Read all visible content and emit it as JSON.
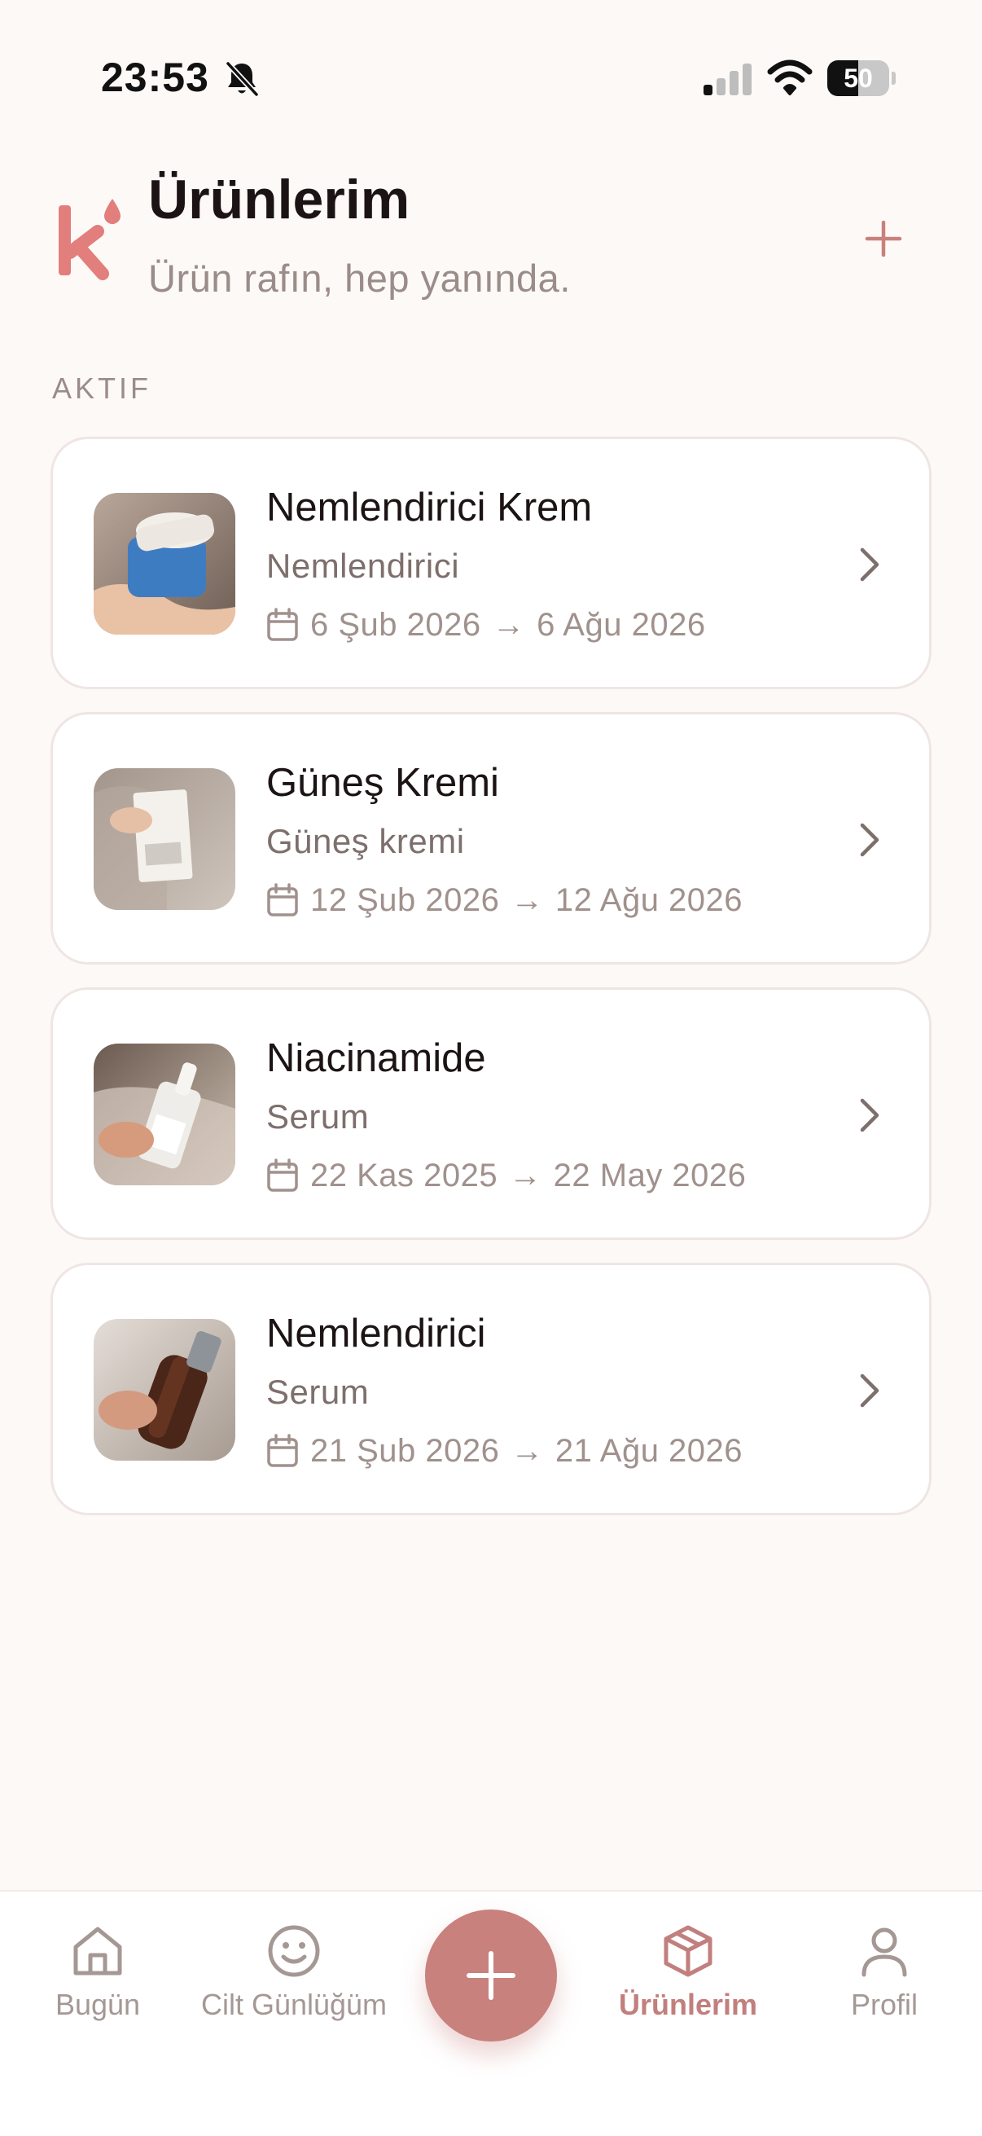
{
  "status_bar": {
    "time": "23:53",
    "battery_level": "50",
    "battery_fraction": 0.5
  },
  "header": {
    "title": "Ürünlerim",
    "subtitle": "Ürün rafın, hep yanında.",
    "add_icon": "plus-icon",
    "logo_icon": "k-drop-logo"
  },
  "section": {
    "label": "AKTIF"
  },
  "products": [
    {
      "name": "Nemlendirici Krem",
      "category": "Nemlendirici",
      "start": "6 Şub 2026",
      "end": "6 Ağu 2026"
    },
    {
      "name": "Güneş Kremi",
      "category": "Güneş kremi",
      "start": "12 Şub 2026",
      "end": "12 Ağu 2026"
    },
    {
      "name": "Niacinamide",
      "category": "Serum",
      "start": "22 Kas 2025",
      "end": "22 May 2026"
    },
    {
      "name": "Nemlendirici",
      "category": "Serum",
      "start": "21 Şub 2026",
      "end": "21 Ağu 2026"
    }
  ],
  "date_arrow": "→",
  "nav": {
    "items": [
      {
        "label": "Bugün",
        "icon": "home-icon",
        "active": false
      },
      {
        "label": "Cilt Günlüğüm",
        "icon": "smile-icon",
        "active": false
      },
      {
        "label": "Ürünlerim",
        "icon": "box-icon",
        "active": true
      },
      {
        "label": "Profil",
        "icon": "user-icon",
        "active": false
      }
    ],
    "fab_icon": "plus-icon"
  },
  "colors": {
    "accent": "#C8817D",
    "logo": "#E27E7C",
    "background": "#FDF9F7"
  }
}
